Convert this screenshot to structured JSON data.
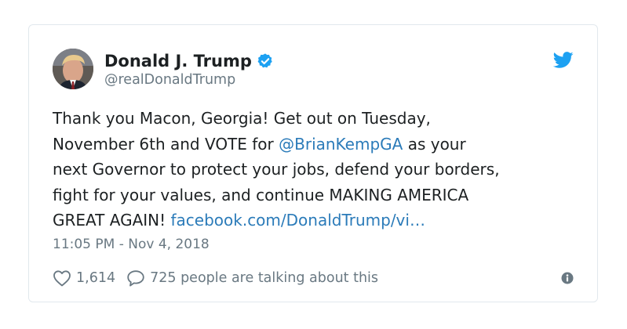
{
  "author": {
    "name": "Donald J. Trump",
    "handle": "@realDonaldTrump",
    "verified": true
  },
  "tweet": {
    "lines": [
      [
        {
          "text": "Thank you Macon, Georgia! Get out on Tuesday,",
          "link": false
        }
      ],
      [
        {
          "text": "November 6th and VOTE for ",
          "link": false
        },
        {
          "text": "@BrianKempGA",
          "link": true
        },
        {
          "text": " as your",
          "link": false
        }
      ],
      [
        {
          "text": "next Governor to protect your jobs, defend your borders,",
          "link": false
        }
      ],
      [
        {
          "text": "fight for your values, and continue MAKING AMERICA",
          "link": false
        }
      ],
      [
        {
          "text": "GREAT AGAIN! ",
          "link": false
        },
        {
          "text": "facebook.com/DonaldTrump/vi…",
          "link": true
        }
      ]
    ]
  },
  "timestamp": "11:05 PM - Nov 4, 2018",
  "actions": {
    "likes": "1,614",
    "talking": "725 people are talking about this"
  },
  "icons": {
    "avatar": "avatar-photo",
    "verified": "verified-badge-icon",
    "brand": "twitter-bird-icon",
    "like": "heart-icon",
    "reply": "speech-bubble-icon",
    "info": "info-icon"
  },
  "colors": {
    "text": "#1c2022",
    "muted": "#697882",
    "link": "#2b7bb9",
    "twitter_blue": "#1da1f2",
    "border": "#e1e8ed"
  }
}
